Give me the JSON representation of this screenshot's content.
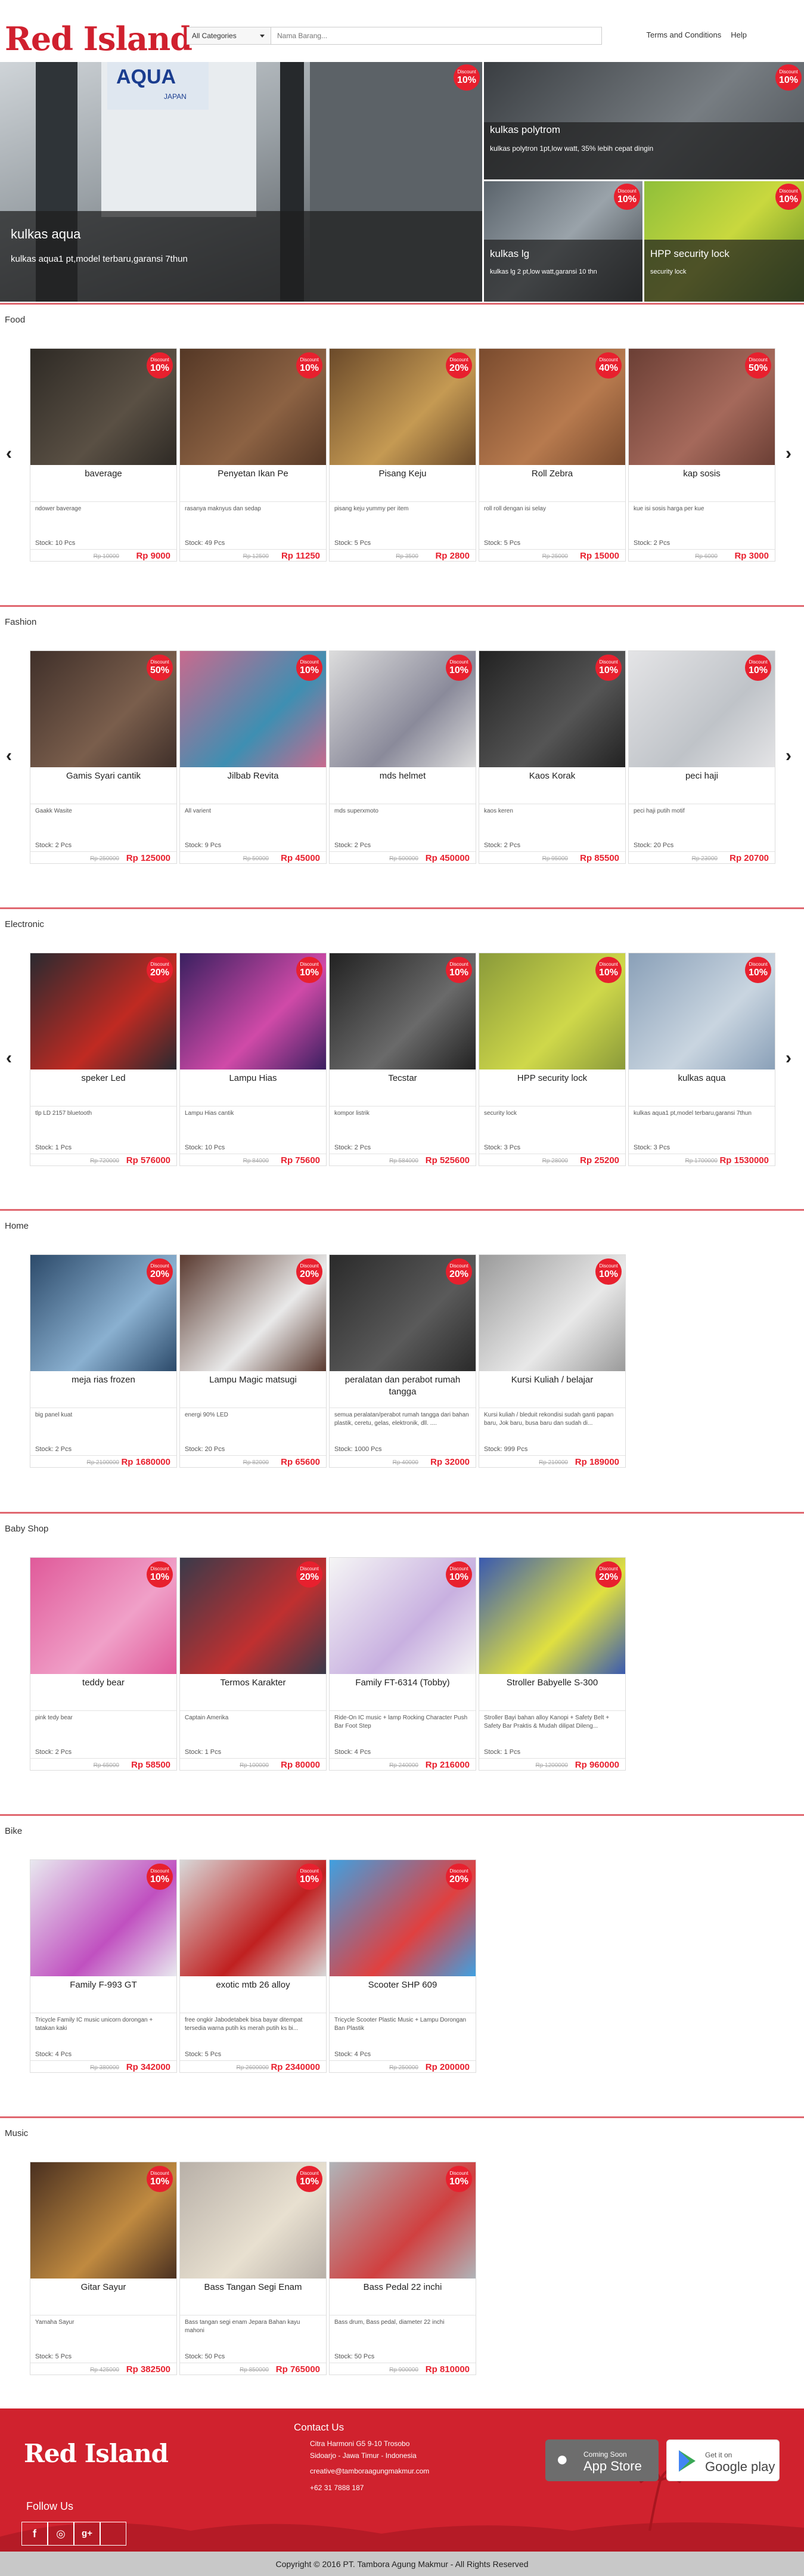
{
  "header": {
    "logo_text": "Red Island",
    "category_select": "All Categories",
    "search_placeholder": "Nama Barang...",
    "links": [
      "Terms and Conditions",
      "Help"
    ]
  },
  "hero": {
    "main": {
      "title": "kulkas aqua",
      "desc": "kulkas aqua1 pt,model terbaru,garansi 7thun"
    },
    "top_right": {
      "title": "kulkas polytrom",
      "desc": "kulkas polytron 1pt,low watt, 35% lebih cepat dingin",
      "badge_label": "Discount",
      "badge_value": "10%"
    },
    "bottom_left": {
      "title": "kulkas lg",
      "desc": "kulkas lg 2 pt,low watt,garansi 10 thn",
      "badge_label": "Discount",
      "badge_value": "10%"
    },
    "bottom_right": {
      "title": "HPP security lock",
      "desc": "security lock",
      "badge_label": "Discount",
      "badge_value": "10%"
    },
    "main_badge_label": "Discount",
    "main_badge_value": "10%"
  },
  "sections": [
    {
      "title": "Food",
      "products": [
        {
          "name": "baverage",
          "desc": "ndower baverage",
          "stock": "Stock: 10 Pcs",
          "old": "Rp 10000",
          "price": "Rp 9000",
          "discount": "10%"
        },
        {
          "name": "Penyetan Ikan Pe",
          "desc": "rasanya maknyus dan sedap",
          "stock": "Stock: 49 Pcs",
          "old": "Rp 12500",
          "price": "Rp 11250",
          "discount": "10%"
        },
        {
          "name": "Pisang Keju",
          "desc": "pisang keju yummy per item",
          "stock": "Stock: 5 Pcs",
          "old": "Rp 3500",
          "price": "Rp 2800",
          "discount": "20%"
        },
        {
          "name": "Roll Zebra",
          "desc": "roll roll dengan isi selay",
          "stock": "Stock: 5 Pcs",
          "old": "Rp 25000",
          "price": "Rp 15000",
          "discount": "40%"
        },
        {
          "name": "kap sosis",
          "desc": "kue isi sosis harga per kue",
          "stock": "Stock: 2 Pcs",
          "old": "Rp 6000",
          "price": "Rp 3000",
          "discount": "50%"
        }
      ]
    },
    {
      "title": "Fashion",
      "products": [
        {
          "name": "Gamis Syari cantik",
          "desc": "Gaakk Wasite",
          "stock": "Stock: 2 Pcs",
          "old": "Rp 250000",
          "price": "Rp 125000",
          "discount": "50%"
        },
        {
          "name": "Jilbab Revita",
          "desc": "All varient",
          "stock": "Stock: 9 Pcs",
          "old": "Rp 50000",
          "price": "Rp 45000",
          "discount": "10%"
        },
        {
          "name": "mds helmet",
          "desc": "mds superxmoto",
          "stock": "Stock: 2 Pcs",
          "old": "Rp 500000",
          "price": "Rp 450000",
          "discount": "10%"
        },
        {
          "name": "Kaos Korak",
          "desc": "kaos keren",
          "stock": "Stock: 2 Pcs",
          "old": "Rp 95000",
          "price": "Rp 85500",
          "discount": "10%"
        },
        {
          "name": "peci haji",
          "desc": "peci haji putih motif",
          "stock": "Stock: 20 Pcs",
          "old": "Rp 23000",
          "price": "Rp 20700",
          "discount": "10%"
        }
      ]
    },
    {
      "title": "Electronic",
      "products": [
        {
          "name": "speker Led",
          "desc": "tlp LD 2157 bluetooth",
          "stock": "Stock: 1 Pcs",
          "old": "Rp 720000",
          "price": "Rp 576000",
          "discount": "20%"
        },
        {
          "name": "Lampu Hias",
          "desc": "Lampu Hias cantik",
          "stock": "Stock: 10 Pcs",
          "old": "Rp 84000",
          "price": "Rp 75600",
          "discount": "10%"
        },
        {
          "name": "Tecstar",
          "desc": "kompor listrik",
          "stock": "Stock: 2 Pcs",
          "old": "Rp 584000",
          "price": "Rp 525600",
          "discount": "10%"
        },
        {
          "name": "HPP security lock",
          "desc": "security lock",
          "stock": "Stock: 3 Pcs",
          "old": "Rp 28000",
          "price": "Rp 25200",
          "discount": "10%"
        },
        {
          "name": "kulkas aqua",
          "desc": "kulkas aqua1 pt,model terbaru,garansi 7thun",
          "stock": "Stock: 3 Pcs",
          "old": "Rp 1700000",
          "price": "Rp 1530000",
          "discount": "10%"
        }
      ]
    },
    {
      "title": "Home",
      "products": [
        {
          "name": "meja rias frozen",
          "desc": "big panel kuat",
          "stock": "Stock: 2 Pcs",
          "old": "Rp 2100000",
          "price": "Rp 1680000",
          "discount": "20%"
        },
        {
          "name": "Lampu Magic matsugi",
          "desc": "energi 90% LED",
          "stock": "Stock: 20 Pcs",
          "old": "Rp 82000",
          "price": "Rp 65600",
          "discount": "20%"
        },
        {
          "name": "peralatan dan perabot rumah tangga",
          "desc": "semua peralatan/perabot rumah tangga dari bahan plastik, ceretu, gelas, elektronik, dll. ....",
          "stock": "Stock: 1000 Pcs",
          "old": "Rp 40000",
          "price": "Rp 32000",
          "discount": "20%"
        },
        {
          "name": "Kursi Kuliah / belajar",
          "desc": "Kursi kuliah / bleduit rekondisi sudah ganti papan baru, Jok baru, busa baru dan sudah di...",
          "stock": "Stock: 999 Pcs",
          "old": "Rp 210000",
          "price": "Rp 189000",
          "discount": "10%"
        }
      ]
    },
    {
      "title": "Baby Shop",
      "products": [
        {
          "name": "teddy bear",
          "desc": "pink tedy bear",
          "stock": "Stock: 2 Pcs",
          "old": "Rp 65000",
          "price": "Rp 58500",
          "discount": "10%"
        },
        {
          "name": "Termos Karakter",
          "desc": "Captain Amerika",
          "stock": "Stock: 1 Pcs",
          "old": "Rp 100000",
          "price": "Rp 80000",
          "discount": "20%"
        },
        {
          "name": "Family FT-6314 (Tobby)",
          "desc": "Ride-On IC music + lamp Rocking Character Push Bar Foot Step",
          "stock": "Stock: 4 Pcs",
          "old": "Rp 240000",
          "price": "Rp 216000",
          "discount": "10%"
        },
        {
          "name": "Stroller Babyelle S-300",
          "desc": "Stroller Bayi bahan alloy Kanopi + Safety Belt + Safety Bar Praktis & Mudah dilipat Dileng...",
          "stock": "Stock: 1 Pcs",
          "old": "Rp 1200000",
          "price": "Rp 960000",
          "discount": "20%"
        }
      ]
    },
    {
      "title": "Bike",
      "products": [
        {
          "name": "Family F-993 GT",
          "desc": "Tricycle Family IC music unicorn dorongan + tatakan kaki",
          "stock": "Stock: 4 Pcs",
          "old": "Rp 380000",
          "price": "Rp 342000",
          "discount": "10%"
        },
        {
          "name": "exotic mtb 26 alloy",
          "desc": "free ongkir Jabodetabek bisa bayar ditempat tersedia warna putih ks merah putih ks bi...",
          "stock": "Stock: 5 Pcs",
          "old": "Rp 2600000",
          "price": "Rp 2340000",
          "discount": "10%"
        },
        {
          "name": "Scooter SHP 609",
          "desc": "Tricycle Scooter Plastic Music + Lampu Dorongan Ban Plastik",
          "stock": "Stock: 4 Pcs",
          "old": "Rp 250000",
          "price": "Rp 200000",
          "discount": "20%"
        }
      ]
    },
    {
      "title": "Music",
      "products": [
        {
          "name": "Gitar Sayur",
          "desc": "Yamaha Sayur",
          "stock": "Stock: 5 Pcs",
          "old": "Rp 425000",
          "price": "Rp 382500",
          "discount": "10%"
        },
        {
          "name": "Bass Tangan Segi Enam",
          "desc": "Bass tangan segi enam Jepara Bahan kayu mahoni",
          "stock": "Stock: 50 Pcs",
          "old": "Rp 850000",
          "price": "Rp 765000",
          "discount": "10%"
        },
        {
          "name": "Bass Pedal 22 inchi",
          "desc": "Bass drum, Bass pedal, diameter 22 inchi",
          "stock": "Stock: 50 Pcs",
          "old": "Rp 900000",
          "price": "Rp 810000",
          "discount": "10%"
        }
      ]
    }
  ],
  "badge_label": "Discount",
  "footer": {
    "logo_text": "Red Island",
    "contact_title": "Contact Us",
    "address1": "Citra Harmoni G5 9-10 Trosobo",
    "address2": "Sidoarjo - Jawa Timur - Indonesia",
    "email": "creative@tamboraagungmakmur.com",
    "phone": "+62 31 7888 187",
    "follow_us": "Follow Us",
    "app_store_small": "Coming Soon",
    "app_store": "App Store",
    "google_small": "Get it on",
    "google": "Google play",
    "copyright": "Copyright © 2016 PT. Tambora Agung Makmur - All Rights Reserved"
  },
  "colors": {
    "accent": "#e8202e",
    "footer": "#d0222e"
  }
}
